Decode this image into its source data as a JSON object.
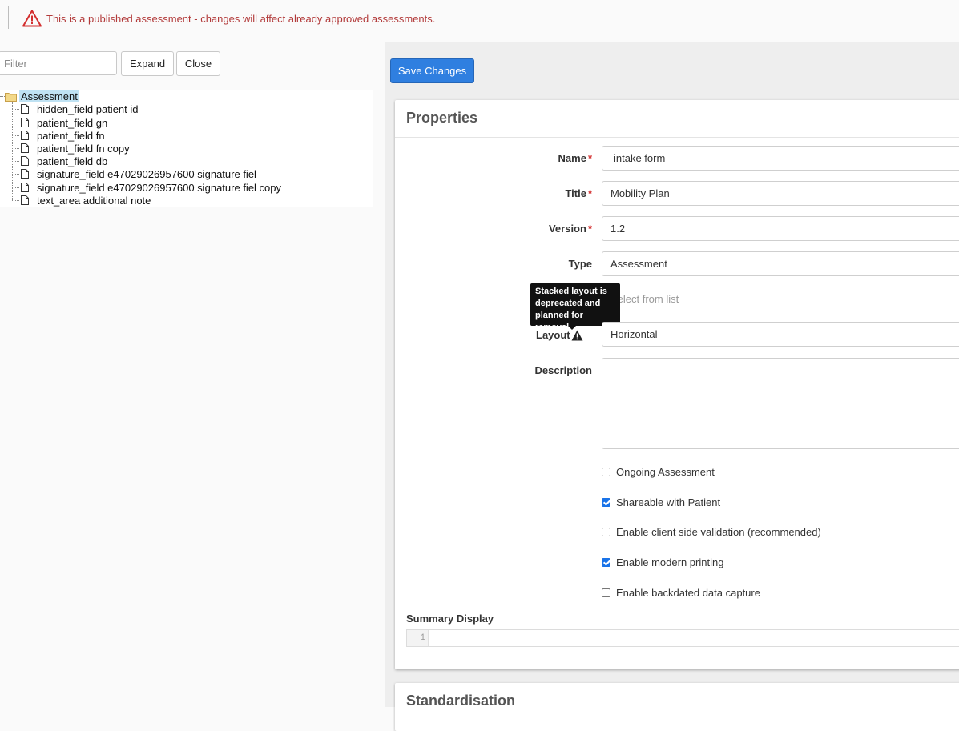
{
  "warning": {
    "text": "This is a published assessment - changes will affect already approved assessments.",
    "icon": "warning-triangle-icon",
    "color": "#b23a3a"
  },
  "left": {
    "filter_placeholder": "Filter",
    "expand_label": "Expand",
    "close_label": "Close",
    "tree": {
      "root": "Assessment",
      "items": [
        "hidden_field patient id",
        "patient_field gn",
        "patient_field fn",
        "patient_field fn copy",
        "patient_field db",
        "signature_field e47029026957600 signature fiel",
        "signature_field e47029026957600 signature fiel copy",
        "text_area additional note"
      ]
    }
  },
  "right": {
    "save_label": "Save Changes",
    "accent_color": "#2f7fe0",
    "properties": {
      "title": "Properties",
      "name_label": "Name",
      "name_value": "intake form",
      "title_label": "Title",
      "title_value": "Mobility Plan",
      "version_label": "Version",
      "version_value": "1.2",
      "type_label": "Type",
      "type_value": "Assessment",
      "select_placeholder": "Select from list",
      "layout_label": "Layout",
      "layout_value": "Horizontal",
      "tooltip": "Stacked layout is deprecated and planned for removal",
      "description_label": "Description",
      "checkboxes": [
        {
          "label": "Ongoing Assessment",
          "checked": false
        },
        {
          "label": "Shareable with Patient",
          "checked": true
        },
        {
          "label": "Enable client side validation (recommended)",
          "checked": false
        },
        {
          "label": "Enable modern printing",
          "checked": true
        },
        {
          "label": "Enable backdated data capture",
          "checked": false
        }
      ],
      "summary_label": "Summary Display",
      "line_number": "1"
    },
    "standardisation_title": "Standardisation"
  }
}
